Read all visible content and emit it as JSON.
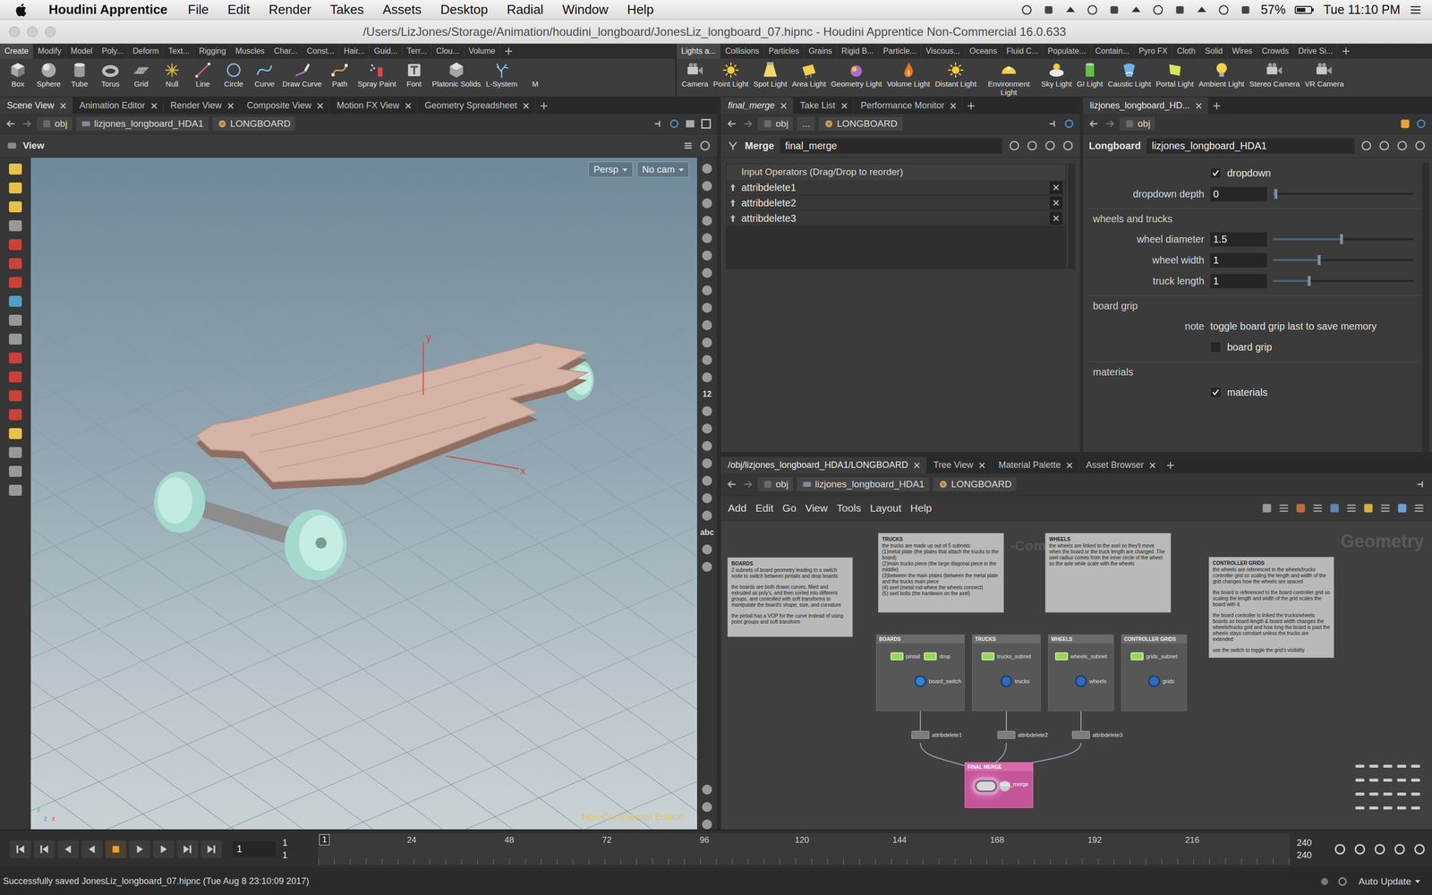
{
  "menubar": {
    "app": "Houdini Apprentice",
    "menus": [
      "File",
      "Edit",
      "Render",
      "Takes",
      "Assets",
      "Desktop",
      "Radial",
      "Window",
      "Help"
    ],
    "battery": "57%",
    "clock": "Tue 11:10 PM"
  },
  "window": {
    "title": "/Users/LizJones/Storage/Animation/houdini_longboard/JonesLiz_longboard_07.hipnc - Houdini Apprentice Non-Commercial 16.0.633"
  },
  "shelf": {
    "left": {
      "tabs": [
        {
          "label": "Create",
          "selected": true
        },
        {
          "label": "Modify",
          "selected": false
        },
        {
          "label": "Model",
          "selected": false
        },
        {
          "label": "Poly...",
          "selected": false
        },
        {
          "label": "Deform",
          "selected": false
        },
        {
          "label": "Text...",
          "selected": false
        },
        {
          "label": "Rigging",
          "selected": false
        },
        {
          "label": "Muscles",
          "selected": false
        },
        {
          "label": "Char...",
          "selected": false
        },
        {
          "label": "Const...",
          "selected": false
        },
        {
          "label": "Hair...",
          "selected": false
        },
        {
          "label": "Guid...",
          "selected": false
        },
        {
          "label": "Terr...",
          "selected": false
        },
        {
          "label": "Clou...",
          "selected": false
        },
        {
          "label": "Volume",
          "selected": false
        }
      ],
      "tools": [
        "Box",
        "Sphere",
        "Tube",
        "Torus",
        "Grid",
        "Null",
        "Line",
        "Circle",
        "Curve",
        "Draw Curve",
        "Path",
        "Spray Paint",
        "Font",
        "Platonic Solids",
        "L-System",
        "M"
      ]
    },
    "right": {
      "tabs": [
        {
          "label": "Lights a...",
          "selected": true
        },
        {
          "label": "Collisions",
          "selected": false
        },
        {
          "label": "Particles",
          "selected": false
        },
        {
          "label": "Grains",
          "selected": false
        },
        {
          "label": "Rigid B...",
          "selected": false
        },
        {
          "label": "Particle...",
          "selected": false
        },
        {
          "label": "Viscous...",
          "selected": false
        },
        {
          "label": "Oceans",
          "selected": false
        },
        {
          "label": "Fluid C...",
          "selected": false
        },
        {
          "label": "Populate...",
          "selected": false
        },
        {
          "label": "Contain...",
          "selected": false
        },
        {
          "label": "Pyro FX",
          "selected": false
        },
        {
          "label": "Cloth",
          "selected": false
        },
        {
          "label": "Solid",
          "selected": false
        },
        {
          "label": "Wires",
          "selected": false
        },
        {
          "label": "Crowds",
          "selected": false
        },
        {
          "label": "Drive Si...",
          "selected": false
        }
      ],
      "tools": [
        "Camera",
        "Point Light",
        "Spot Light",
        "Area Light",
        "Geometry Light",
        "Volume Light",
        "Distant Light",
        "Environment Light",
        "Sky Light",
        "GI Light",
        "Caustic Light",
        "Portal Light",
        "Ambient Light",
        "Stereo Camera",
        "VR Camera"
      ]
    }
  },
  "scene_pane": {
    "tabs": [
      {
        "label": "Scene View",
        "selected": true
      },
      {
        "label": "Animation Editor",
        "selected": false
      },
      {
        "label": "Render View",
        "selected": false
      },
      {
        "label": "Composite View",
        "selected": false
      },
      {
        "label": "Motion FX View",
        "selected": false
      },
      {
        "label": "Geometry Spreadsheet",
        "selected": false
      }
    ],
    "path": [
      "obj",
      "lizjones_longboard_HDA1",
      "LONGBOARD"
    ],
    "header": "View",
    "camera_menu": [
      "Persp",
      "No cam"
    ],
    "axis_labels": [
      "y",
      "x"
    ],
    "triad_labels": [
      "y",
      "z",
      "x"
    ],
    "watermark": "Non-Commercial Edition",
    "toolbar_texts": [
      "12",
      "abc"
    ]
  },
  "merge_pane": {
    "tabs": [
      {
        "label": "final_merge",
        "selected": true
      },
      {
        "label": "Take List",
        "selected": false
      },
      {
        "label": "Performance Monitor",
        "selected": false
      }
    ],
    "path": [
      "obj",
      "...",
      "LONGBOARD"
    ],
    "type": "Merge",
    "name": "final_merge",
    "list_header": "Input Operators (Drag/Drop to reorder)",
    "inputs": [
      "attribdelete1",
      "attribdelete2",
      "attribdelete3"
    ]
  },
  "asset_pane": {
    "tabs": [
      {
        "label": "lizjones_longboard_HD...",
        "selected": true
      }
    ],
    "path": [
      "obj"
    ],
    "type": "Longboard",
    "name": "lizjones_longboard_HDA1",
    "rows": [
      {
        "kind": "checkbox",
        "label": "dropdown",
        "checked": true
      },
      {
        "kind": "slider",
        "label": "dropdown depth",
        "value": "0",
        "level": 0.02
      },
      {
        "kind": "section",
        "label": "wheels and trucks"
      },
      {
        "kind": "slider",
        "label": "wheel diameter",
        "value": "1.5",
        "level": 0.49
      },
      {
        "kind": "slider",
        "label": "wheel width",
        "value": "1",
        "level": 0.33
      },
      {
        "kind": "slider",
        "label": "truck length",
        "value": "1",
        "level": 0.26
      },
      {
        "kind": "section",
        "label": "board grip"
      },
      {
        "kind": "note",
        "label": "note",
        "value": "toggle board grip last to save memory"
      },
      {
        "kind": "checkbox",
        "label": "board grip",
        "checked": false
      },
      {
        "kind": "section",
        "label": "materials"
      },
      {
        "kind": "checkbox",
        "label": "materials",
        "checked": true
      }
    ]
  },
  "network_pane": {
    "tabs": [
      {
        "label": "/obj/lizjones_longboard_HDA1/LONGBOARD",
        "selected": true
      },
      {
        "label": "Tree View",
        "selected": false
      },
      {
        "label": "Material Palette",
        "selected": false
      },
      {
        "label": "Asset Browser",
        "selected": false
      }
    ],
    "path": [
      "obj",
      "lizjones_longboard_HDA1",
      "LONGBOARD"
    ],
    "menus": [
      "Add",
      "Edit",
      "Go",
      "View",
      "Tools",
      "Layout",
      "Help"
    ],
    "context": "Geometry",
    "watermark_fragment": "-Com",
    "notes": [
      {
        "title": "BOARDS",
        "paragraphs": [
          [
            "2 subnets of board geometry leading to a switch node to switch between pintails and drop boards"
          ],
          [
            "the boards are both drawn curves, filled and extruded as poly's, and then sorted into different groups, and controlled with soft transforms to manipulate the board's shape, size, and curvature"
          ],
          [
            "the pintail has a VOP for the curve instead of using point groups and soft transform"
          ]
        ]
      },
      {
        "title": "TRUCKS",
        "paragraphs": [
          [
            "the trucks are made up out of 5 subnets:",
            "(1)metal plate (the plates that attach the trucks to the board)",
            "(2)main trucks piece (the large diagonal piece in the middle)",
            "(3)between the main plates (between the metal plate and the trucks main piece",
            "(4) axel (metal rod where the wheels connect)",
            "(5) axel bolts (the hardware on the axel)"
          ]
        ]
      },
      {
        "title": "WHEELS",
        "paragraphs": [
          [
            "the wheels are linked to the axel so they'll move when the board or the truck length are changed. The axel radius comes from the inner circle of the wheel so the axle while scale with the wheels"
          ]
        ]
      },
      {
        "title": "CONTROLLER GRIDS",
        "paragraphs": [
          [
            "the wheels are referenced to the wheels/trucks controller grid so scaling the length and width of the grid changes how the wheels are spaced"
          ],
          [
            "the board is referenced to the board controller grid so scaling the length and width of the grid scales the board with it"
          ],
          [
            "the board controller is linked the trucks/wheels boards so board length & board width changes the wheels/trucks grid and how long the board is past the wheels stays constant unless the trucks are extended"
          ],
          [
            "use the switch to toggle the grid's visibility"
          ]
        ]
      }
    ],
    "boxes": [
      {
        "title": "BOARDS",
        "subnets": [
          "pintail",
          "drop"
        ],
        "output": "board_switch",
        "output_kind": "switch"
      },
      {
        "title": "TRUCKS",
        "subnets": [
          "trucks_subnet"
        ],
        "output": "trucks",
        "output_kind": "object"
      },
      {
        "title": "WHEELS",
        "subnets": [
          "wheels_subnet"
        ],
        "output": "wheels",
        "output_kind": "object"
      },
      {
        "title": "CONTROLLER GRIDS",
        "subnets": [
          "grids_subnet"
        ],
        "output": "grids",
        "output_kind": "object"
      }
    ],
    "attrib_nodes": [
      "attribdelete1",
      "attribdelete2",
      "attribdelete3"
    ],
    "merge_box": {
      "title": "FINAL MERGE",
      "node": "final_merge",
      "selected": true
    }
  },
  "timeline": {
    "frame": "1",
    "range_start": [
      "1",
      "1"
    ],
    "range_end": [
      "240",
      "240"
    ],
    "current": "1",
    "ticks": [
      "24",
      "48",
      "72",
      "96",
      "120",
      "144",
      "168",
      "192",
      "216"
    ],
    "playing": false
  },
  "status_bar": {
    "message": "Successfully saved JonesLiz_longboard_07.hipnc (Tue Aug 8 23:10:09 2017)",
    "update_mode": "Auto Update"
  }
}
